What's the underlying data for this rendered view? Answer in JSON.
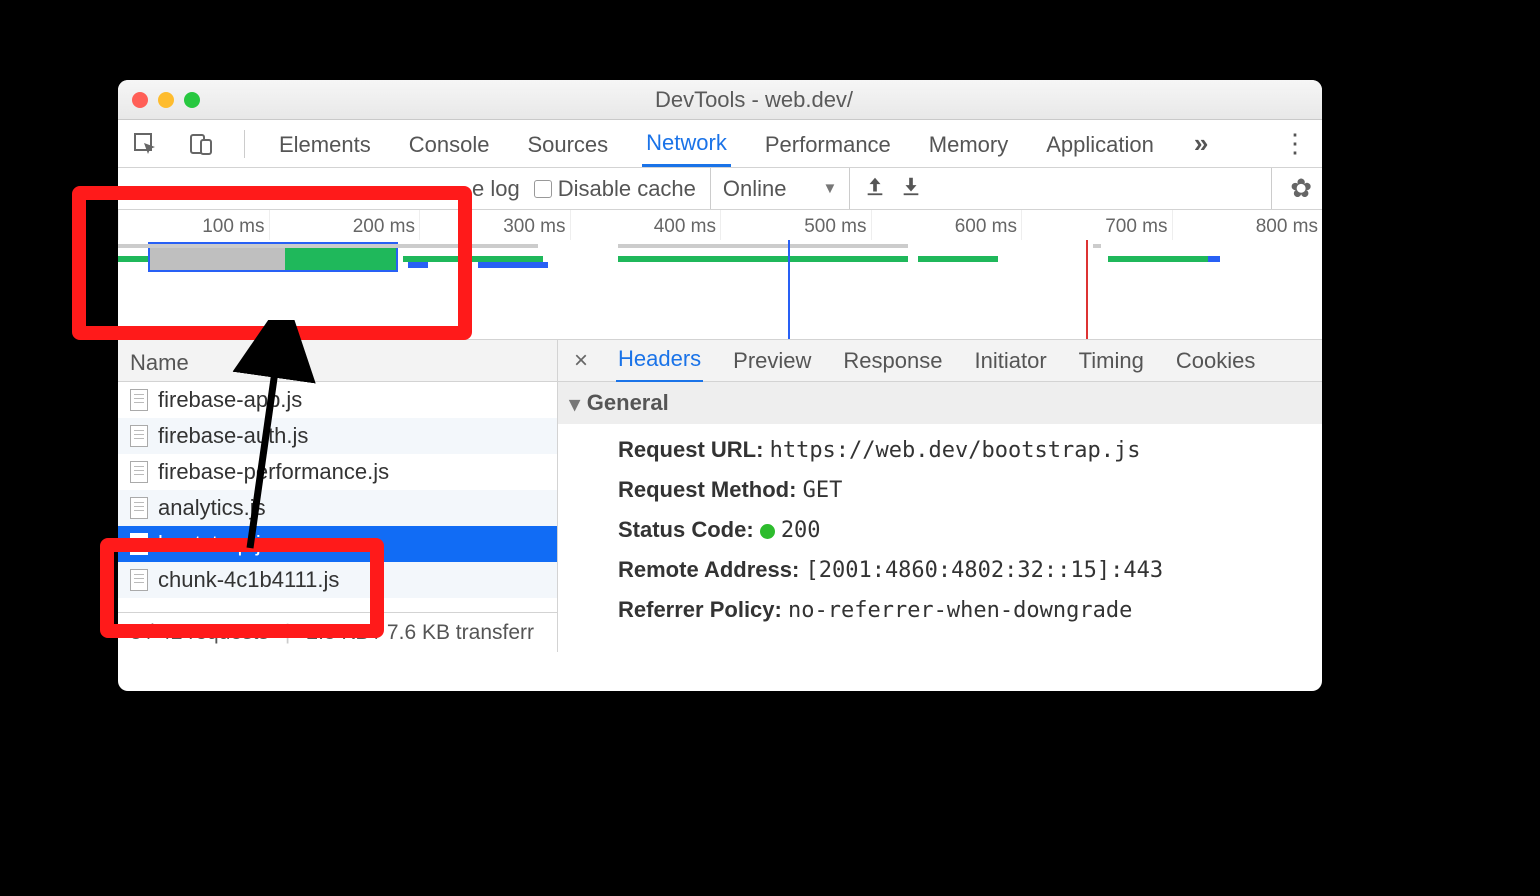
{
  "window": {
    "title": "DevTools - web.dev/"
  },
  "tabs": {
    "items": [
      "Elements",
      "Console",
      "Sources",
      "Network",
      "Performance",
      "Memory",
      "Application"
    ],
    "active": "Network",
    "more": "»"
  },
  "toolbar": {
    "preserve_log": "e log",
    "disable_cache": "Disable cache",
    "throttle": "Online"
  },
  "overview": {
    "ticks": [
      "100 ms",
      "200 ms",
      "300 ms",
      "400 ms",
      "500 ms",
      "600 ms",
      "700 ms",
      "800 ms"
    ]
  },
  "name_col": "Name",
  "detail_tabs": {
    "items": [
      "Headers",
      "Preview",
      "Response",
      "Initiator",
      "Timing",
      "Cookies"
    ],
    "active": "Headers"
  },
  "requests": [
    {
      "name": "firebase-app.js"
    },
    {
      "name": "firebase-auth.js"
    },
    {
      "name": "firebase-performance.js"
    },
    {
      "name": "analytics.js"
    },
    {
      "name": "bootstrap.js"
    },
    {
      "name": "chunk-4c1b4111.js"
    }
  ],
  "selected_index": 4,
  "status_bar": {
    "reqs": "8 / 42 requests",
    "xfer": "2.3 KB / 7.6 KB transferr"
  },
  "headers": {
    "section": "General",
    "items": [
      {
        "k": "Request URL:",
        "v": "https://web.dev/bootstrap.js",
        "mono": true
      },
      {
        "k": "Request Method:",
        "v": "GET",
        "mono": true
      },
      {
        "k": "Status Code:",
        "v": "200",
        "mono": true,
        "dot": true
      },
      {
        "k": "Remote Address:",
        "v": "[2001:4860:4802:32::15]:443",
        "mono": true
      },
      {
        "k": "Referrer Policy:",
        "v": "no-referrer-when-downgrade",
        "mono": true
      }
    ]
  }
}
